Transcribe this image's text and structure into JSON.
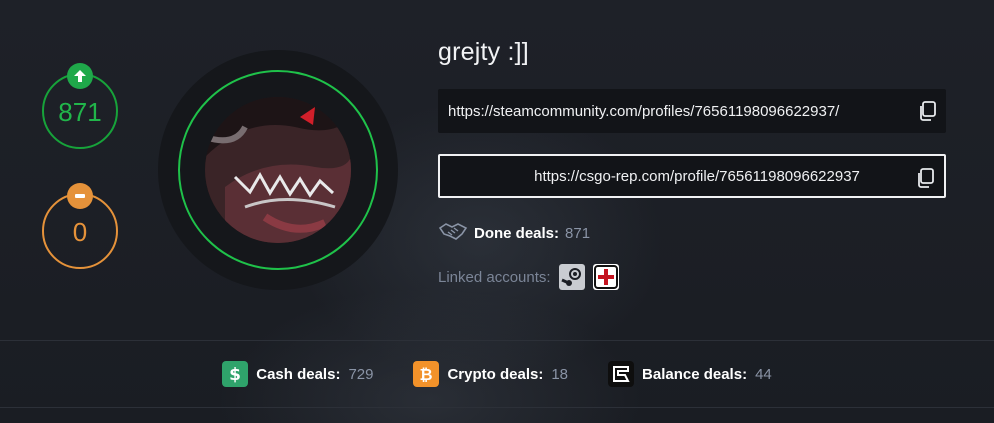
{
  "reputation": {
    "positive": "871",
    "negative": "0"
  },
  "profile": {
    "username": "grejty :]]",
    "steam_url": "https://steamcommunity.com/profiles/76561198096622937/",
    "rep_url": "https://csgo-rep.com/profile/76561198096622937",
    "done_deals_label": "Done deals:",
    "done_deals_value": "871",
    "linked_accounts_label": "Linked accounts:"
  },
  "stats": {
    "cash_label": "Cash deals:",
    "cash_value": "729",
    "crypto_label": "Crypto deals:",
    "crypto_value": "18",
    "balance_label": "Balance deals:",
    "balance_value": "44"
  },
  "colors": {
    "positive": "#21b54a",
    "negative": "#e5923a",
    "cash": "#2fa36b",
    "crypto": "#f2922a",
    "balance": "#0e0e0e"
  },
  "icons": {
    "copy": "copy-icon",
    "handshake": "handshake-icon",
    "steam": "steam-icon",
    "rep": "rep-plus-icon",
    "cash": "dollar-icon",
    "crypto": "bitcoin-icon",
    "balance": "skinport-icon"
  }
}
